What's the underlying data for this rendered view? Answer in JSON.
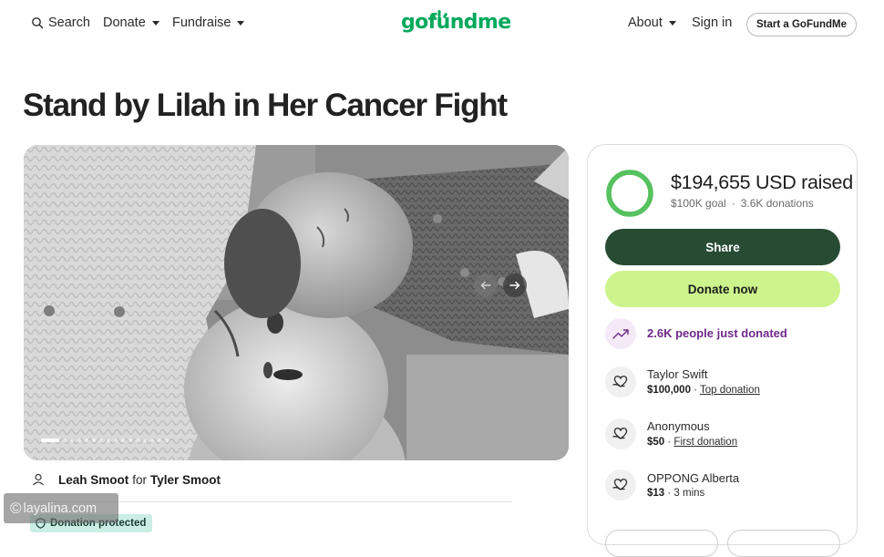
{
  "nav": {
    "search_label": "Search",
    "donate_label": "Donate",
    "fundraise_label": "Fundraise",
    "logo_text": "gofundme",
    "about_label": "About",
    "signin_label": "Sign in",
    "start_label": "Start a GoFundMe"
  },
  "campaign": {
    "title": "Stand by Lilah in Her Cancer Fight",
    "organizer_name": "Leah Smoot",
    "organizer_for": "for",
    "beneficiary_name": "Tyler Smoot",
    "protected_label": "Donation protected",
    "photo": {
      "description_icon": "photo-of-two-babies",
      "slide_count": 16,
      "active_slide": 1
    }
  },
  "donation_card": {
    "raised_text": "$194,655 USD raised",
    "goal_text": "$100K goal",
    "donations_text": "3.6K donations",
    "progress_fraction": 1.0,
    "share_label": "Share",
    "donate_label": "Donate now",
    "recent_text": "2.6K people just donated",
    "donors": [
      {
        "name": "Taylor Swift",
        "amount": "$100,000",
        "note": "Top donation",
        "note_is_link": true
      },
      {
        "name": "Anonymous",
        "amount": "$50",
        "note": "First donation",
        "note_is_link": true
      },
      {
        "name": "OPPONG Alberta",
        "amount": "$13",
        "note": "3 mins",
        "note_is_link": false
      }
    ]
  },
  "watermark": {
    "text": "layalina.com",
    "symbol": "©"
  },
  "colors": {
    "brand_green": "#02a95c",
    "share_button": "#274b33",
    "donate_button": "#cdf48c",
    "progress_ring": "#56c25f",
    "trend_purple": "#6f2a8a",
    "protected_badge": "#cbeee4"
  },
  "icons": {
    "search": "search-icon",
    "user": "user-icon",
    "shield": "shield-icon",
    "trend": "trending-up-icon",
    "heart_hand": "heart-hand-icon",
    "prev": "arrow-left-icon",
    "next": "arrow-right-icon"
  }
}
